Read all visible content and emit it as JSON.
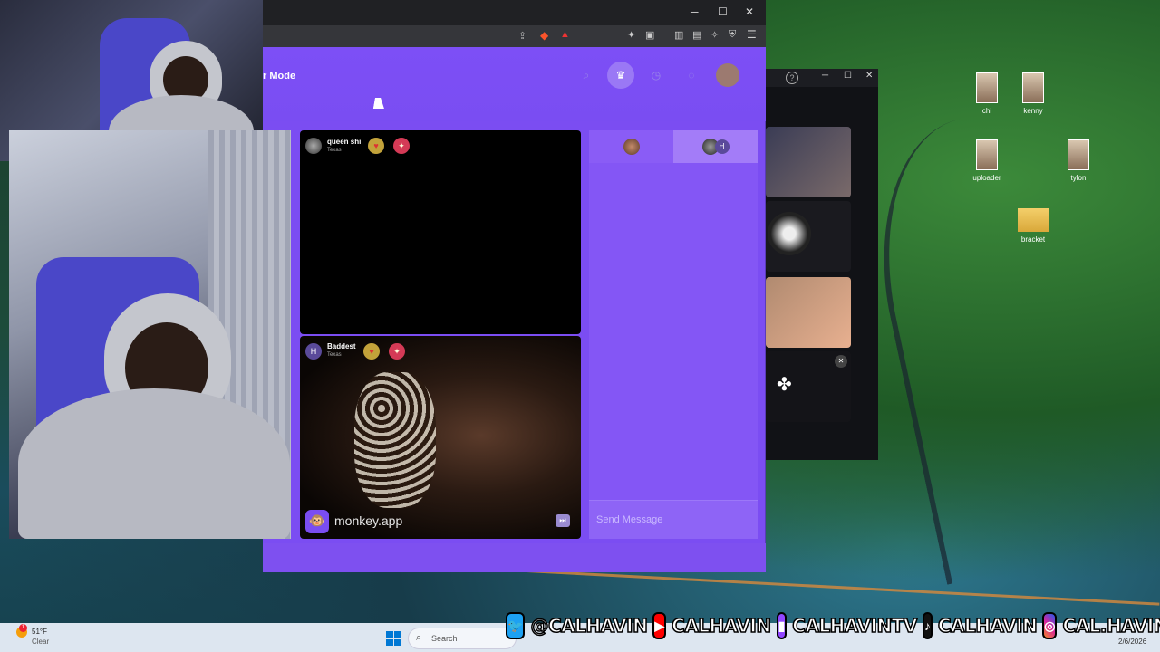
{
  "desktop": {
    "icons": [
      {
        "label": "chi"
      },
      {
        "label": "kenny"
      },
      {
        "label": "uploader"
      },
      {
        "label": "tylon"
      },
      {
        "label": "bracket"
      }
    ]
  },
  "browser": {
    "mode_label": "r Mode",
    "window_controls": {
      "minimize": "─",
      "maximize": "☐",
      "close": "✕"
    },
    "nav_icons": [
      "search-icon",
      "crown-icon",
      "clock-icon",
      "chat-icon",
      "avatar-icon"
    ],
    "accent": "#7b4df2"
  },
  "video_top": {
    "name": "queen shi",
    "location": "Texas"
  },
  "video_bottom": {
    "name": "Baddest",
    "location": "Texas",
    "avatar_letter": "H"
  },
  "branding": {
    "logo_text": "monkey.app",
    "logo_icon": "🐵"
  },
  "chat": {
    "tab2_letter": "H",
    "placeholder": "Send Message"
  },
  "win2": {
    "help": "?",
    "close_x": "✕"
  },
  "taskbar": {
    "weather_temp": "51°F",
    "weather_desc": "Clear",
    "weather_badge": "1",
    "search_placeholder": "Search",
    "date": "2/6/2026"
  },
  "socials": [
    {
      "platform": "twitter",
      "icon": "🐦",
      "color": "#1da1f2",
      "handle": "@CALHAVIN"
    },
    {
      "platform": "youtube",
      "icon": "▶",
      "color": "#ff0000",
      "handle": "CALHAVIN"
    },
    {
      "platform": "twitch",
      "icon": "▮",
      "color": "#9146ff",
      "handle": "CALHAVINTV"
    },
    {
      "platform": "tiktok",
      "icon": "♪",
      "color": "#111111",
      "handle": "CALHAVIN"
    },
    {
      "platform": "instagram",
      "icon": "◎",
      "color": "#d6249f",
      "handle": "CAL.HAVIN"
    }
  ]
}
